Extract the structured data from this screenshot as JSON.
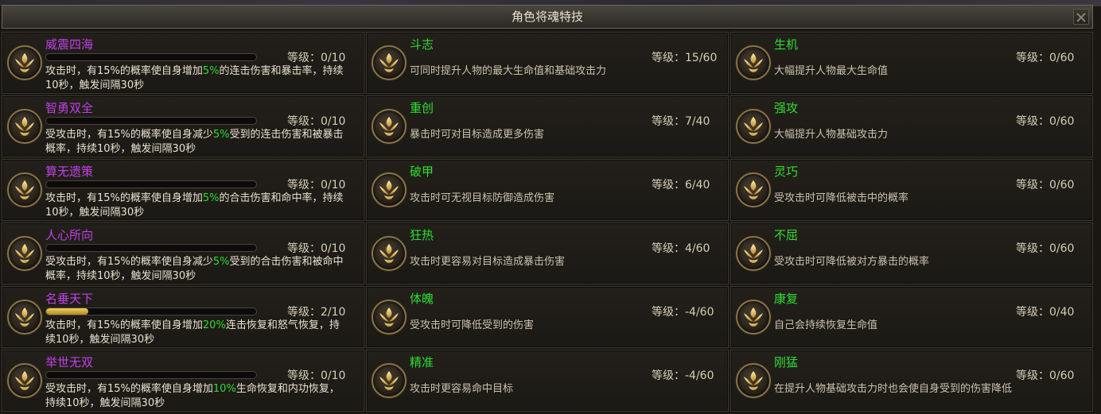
{
  "window": {
    "title": "角色将魂特技"
  },
  "level_label": "等级：",
  "column1": [
    {
      "name": "威震四海",
      "level": "0/10",
      "progress": 0,
      "desc_parts": [
        "攻击时，有15%的概率使自身增加",
        "5%",
        "的连击伤害和暴击率，持续10秒，触发间隔30秒"
      ]
    },
    {
      "name": "智勇双全",
      "level": "0/10",
      "progress": 0,
      "desc_parts": [
        "受攻击时，有15%的概率使自身减少",
        "5%",
        "受到的连击伤害和被暴击概率，持续10秒，触发间隔30秒"
      ]
    },
    {
      "name": "算无遗策",
      "level": "0/10",
      "progress": 0,
      "desc_parts": [
        "攻击时，有15%的概率使自身增加",
        "5%",
        "的合击伤害和命中率，持续10秒，触发间隔30秒"
      ]
    },
    {
      "name": "人心所向",
      "level": "0/10",
      "progress": 0,
      "desc_parts": [
        "受攻击时，有15%的概率使自身减少",
        "5%",
        "受到的合击伤害和被命中概率，持续10秒，触发间隔30秒"
      ]
    },
    {
      "name": "名垂天下",
      "level": "2/10",
      "progress": 0.2,
      "desc_parts": [
        "攻击时，有15%的概率使自身增加",
        "20%",
        "连击恢复和怒气恢复，持续10秒，触发间隔30秒"
      ]
    },
    {
      "name": "举世无双",
      "level": "0/10",
      "progress": 0,
      "desc_parts": [
        "受攻击时，有15%的概率使自身增加",
        "10%",
        "生命恢复和内功恢复，持续10秒，触发间隔30秒"
      ]
    }
  ],
  "column2": [
    {
      "name": "斗志",
      "level": "15/60",
      "desc": "可同时提升人物的最大生命值和基础攻击力"
    },
    {
      "name": "重创",
      "level": "7/40",
      "desc": "暴击时可对目标造成更多伤害"
    },
    {
      "name": "破甲",
      "level": "6/40",
      "desc": "攻击时可无视目标防御造成伤害"
    },
    {
      "name": "狂热",
      "level": "4/60",
      "desc": "攻击时更容易对目标造成暴击伤害"
    },
    {
      "name": "体魄",
      "level": "-4/60",
      "desc": "受攻击时可降低受到的伤害"
    },
    {
      "name": "精准",
      "level": "-4/60",
      "desc": "攻击时更容易命中目标"
    }
  ],
  "column3": [
    {
      "name": "生机",
      "level": "0/60",
      "desc": "大幅提升人物最大生命值"
    },
    {
      "name": "强攻",
      "level": "0/60",
      "desc": "大幅提升人物基础攻击力"
    },
    {
      "name": "灵巧",
      "level": "0/60",
      "desc": "受攻击时可降低被击中的概率"
    },
    {
      "name": "不屈",
      "level": "0/60",
      "desc": "受攻击时可降低被对方暴击的概率"
    },
    {
      "name": "康复",
      "level": "0/40",
      "desc": "自己会持续恢复生命值"
    },
    {
      "name": "刚猛",
      "level": "0/60",
      "desc": "在提升人物基础攻击力时也会使自身受到的伤害降低"
    }
  ],
  "colors": {
    "purple_name": "#c040e8",
    "green_name": "#30dc34",
    "highlight": "#30dc34"
  },
  "icons": {
    "skill": "phoenix-emblem-icon",
    "close": "close-icon"
  }
}
